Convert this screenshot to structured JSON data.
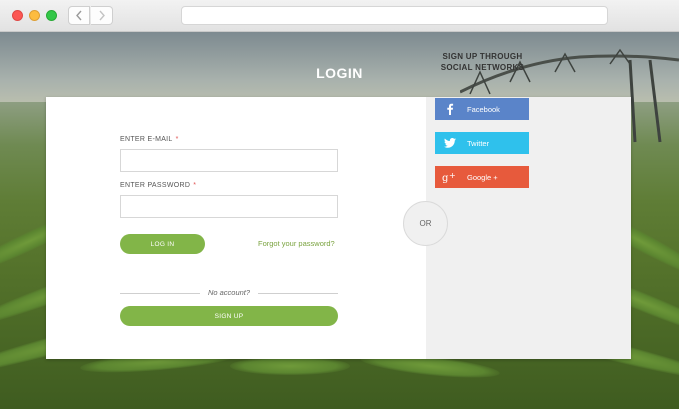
{
  "page": {
    "title": "LOGIN"
  },
  "form": {
    "email_label": "ENTER E-MAIL",
    "email_required": "*",
    "email_value": "",
    "password_label": "ENTER PASSWORD",
    "password_required": "*",
    "password_value": "",
    "login_button": "LOG IN",
    "forgot_link": "Forgot your password?",
    "no_account": "No account?",
    "signup_button": "SIGN UP"
  },
  "divider": {
    "or_label": "OR"
  },
  "social": {
    "title_line1": "SIGN UP THROUGH",
    "title_line2": "SOCIAL NETWORKS",
    "buttons": [
      {
        "label": "Facebook",
        "icon": "facebook-icon",
        "color": "#5a84c9"
      },
      {
        "label": "Twitter",
        "icon": "twitter-icon",
        "color": "#2fc1ec"
      },
      {
        "label": "Google +",
        "icon": "google-plus-icon",
        "color": "#e75a3c"
      }
    ]
  },
  "colors": {
    "accent_green": "#82b548",
    "link_green": "#7aa33f",
    "required_red": "#e05252"
  }
}
